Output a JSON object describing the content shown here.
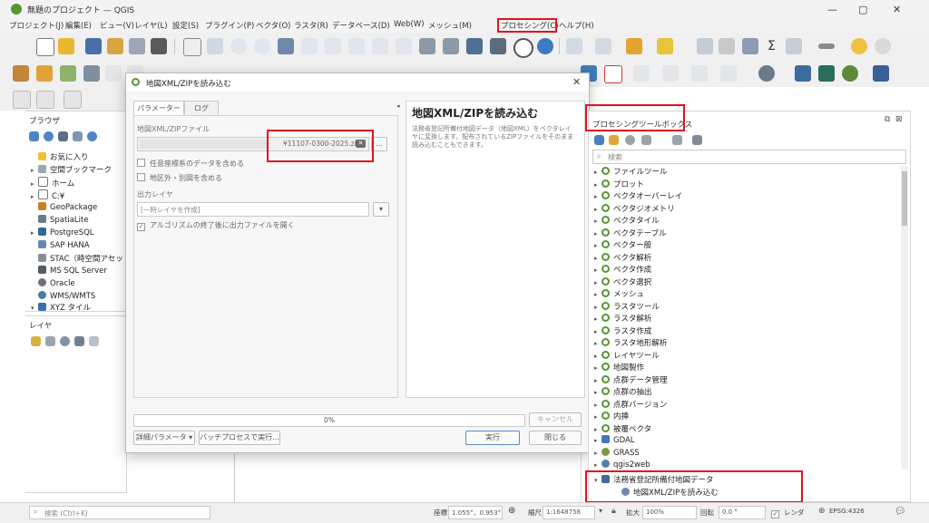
{
  "window": {
    "title": "無題のプロジェクト — QGIS",
    "minimize": "—",
    "maximize": "▢",
    "close": "✕"
  },
  "menu": [
    "プロジェクト(J)",
    "編集(E)",
    "ビュー(V)",
    "レイヤ(L)",
    "設定(S)",
    "プラグイン(P)",
    "ベクタ(O)",
    "ラスタ(R)",
    "データベース(D)",
    "Web(W)",
    "メッシュ(M)",
    "プロセシング(C)",
    "ヘルプ(H)"
  ],
  "browser": {
    "title": "ブラウザ",
    "items": [
      "お気に入り",
      "空間ブックマーク",
      "ホーム",
      "C:¥",
      "GeoPackage",
      "SpatiaLite",
      "PostgreSQL",
      "SAP HANA",
      "STAC（時空間アセッ",
      "MS SQL Server",
      "Oracle",
      "WMS/WMTS",
      "XYZ タイル"
    ]
  },
  "layers": {
    "title": "レイヤ"
  },
  "dialog": {
    "title": "地図XML/ZIPを読み込む",
    "tabs": [
      "パラメーター",
      "ログ"
    ],
    "file_label": "地図XML/ZIPファイル",
    "file_value": "¥11107-0300-2025.zip",
    "browse": "...",
    "check1": "任意座標系のデータを含める",
    "check2": "地区外・別図を含める",
    "output_label": "出力レイヤ",
    "output_placeholder": "[一時レイヤを作成]",
    "check3": "アルゴリズムの終了後に出力ファイルを開く",
    "help_title": "地図XML/ZIPを読み込む",
    "help_text": "法務省登記所備付地図データ（地図XML）をベクタレイヤに変換します。配布されているZIPファイルをそのまま読み込むこともできます。",
    "progress": "0%",
    "cancel": "キャンセル",
    "advanced": "詳細パラメータ ▾",
    "batch": "バッチプロセスで実行...",
    "run": "実行",
    "close": "閉じる"
  },
  "toolbox": {
    "title": "プロセシングツールボックス",
    "search_placeholder": "検索",
    "items": [
      "ファイルツール",
      "プロット",
      "ベクタオーバーレイ",
      "ベクタジオメトリ",
      "ベクタタイル",
      "ベクタテーブル",
      "ベクター般",
      "ベクタ解析",
      "ベクタ作成",
      "ベクタ選択",
      "メッシュ",
      "ラスタツール",
      "ラスタ解析",
      "ラスタ作成",
      "ラスタ地形解析",
      "レイヤツール",
      "地図製作",
      "点群データ管理",
      "点群の抽出",
      "点群バージョン",
      "内挿",
      "被覆ベクタ",
      "GDAL",
      "GRASS",
      "qgis2web"
    ],
    "expanded_group": "法務省登記所備付地図データ",
    "expanded_child": "地図XML/ZIPを読み込む"
  },
  "statusbar": {
    "search_placeholder": "検索 (Ctrl+K)",
    "coord_label": "座標",
    "coord_value": "1.055°，0.953°",
    "scale_label": "縮尺",
    "scale_value": "1:1648758",
    "magnify_label": "拡大",
    "magnify_value": "100%",
    "rotation_label": "回転",
    "rotation_value": "0.0 °",
    "render_label": "レンダ",
    "crs": "EPSG:4326"
  }
}
